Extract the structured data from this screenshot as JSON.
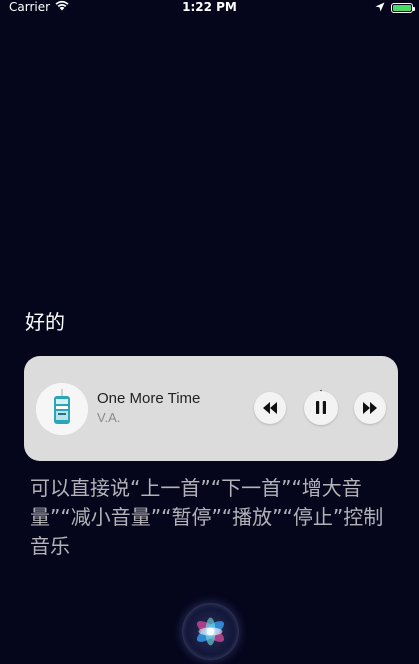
{
  "status_bar": {
    "carrier": "Carrier",
    "time": "1:22 PM",
    "battery_level": 1.0,
    "icons": [
      "wifi-icon",
      "location-arrow-icon",
      "battery-icon"
    ]
  },
  "siri": {
    "response": "好的",
    "hint": "可以直接说“上一首”“下一首”“增大音量”“减小音量”“暂停”“播放”“停止”控制音乐"
  },
  "music_card": {
    "title": "One More Time",
    "artist": "V.A.",
    "controls": [
      "rewind-icon",
      "pause-icon",
      "fast-forward-icon"
    ]
  },
  "colors": {
    "background": "#05061c",
    "card": "#dcdcdc",
    "hint_text": "#b2b2b8",
    "battery": "#4cd964"
  }
}
